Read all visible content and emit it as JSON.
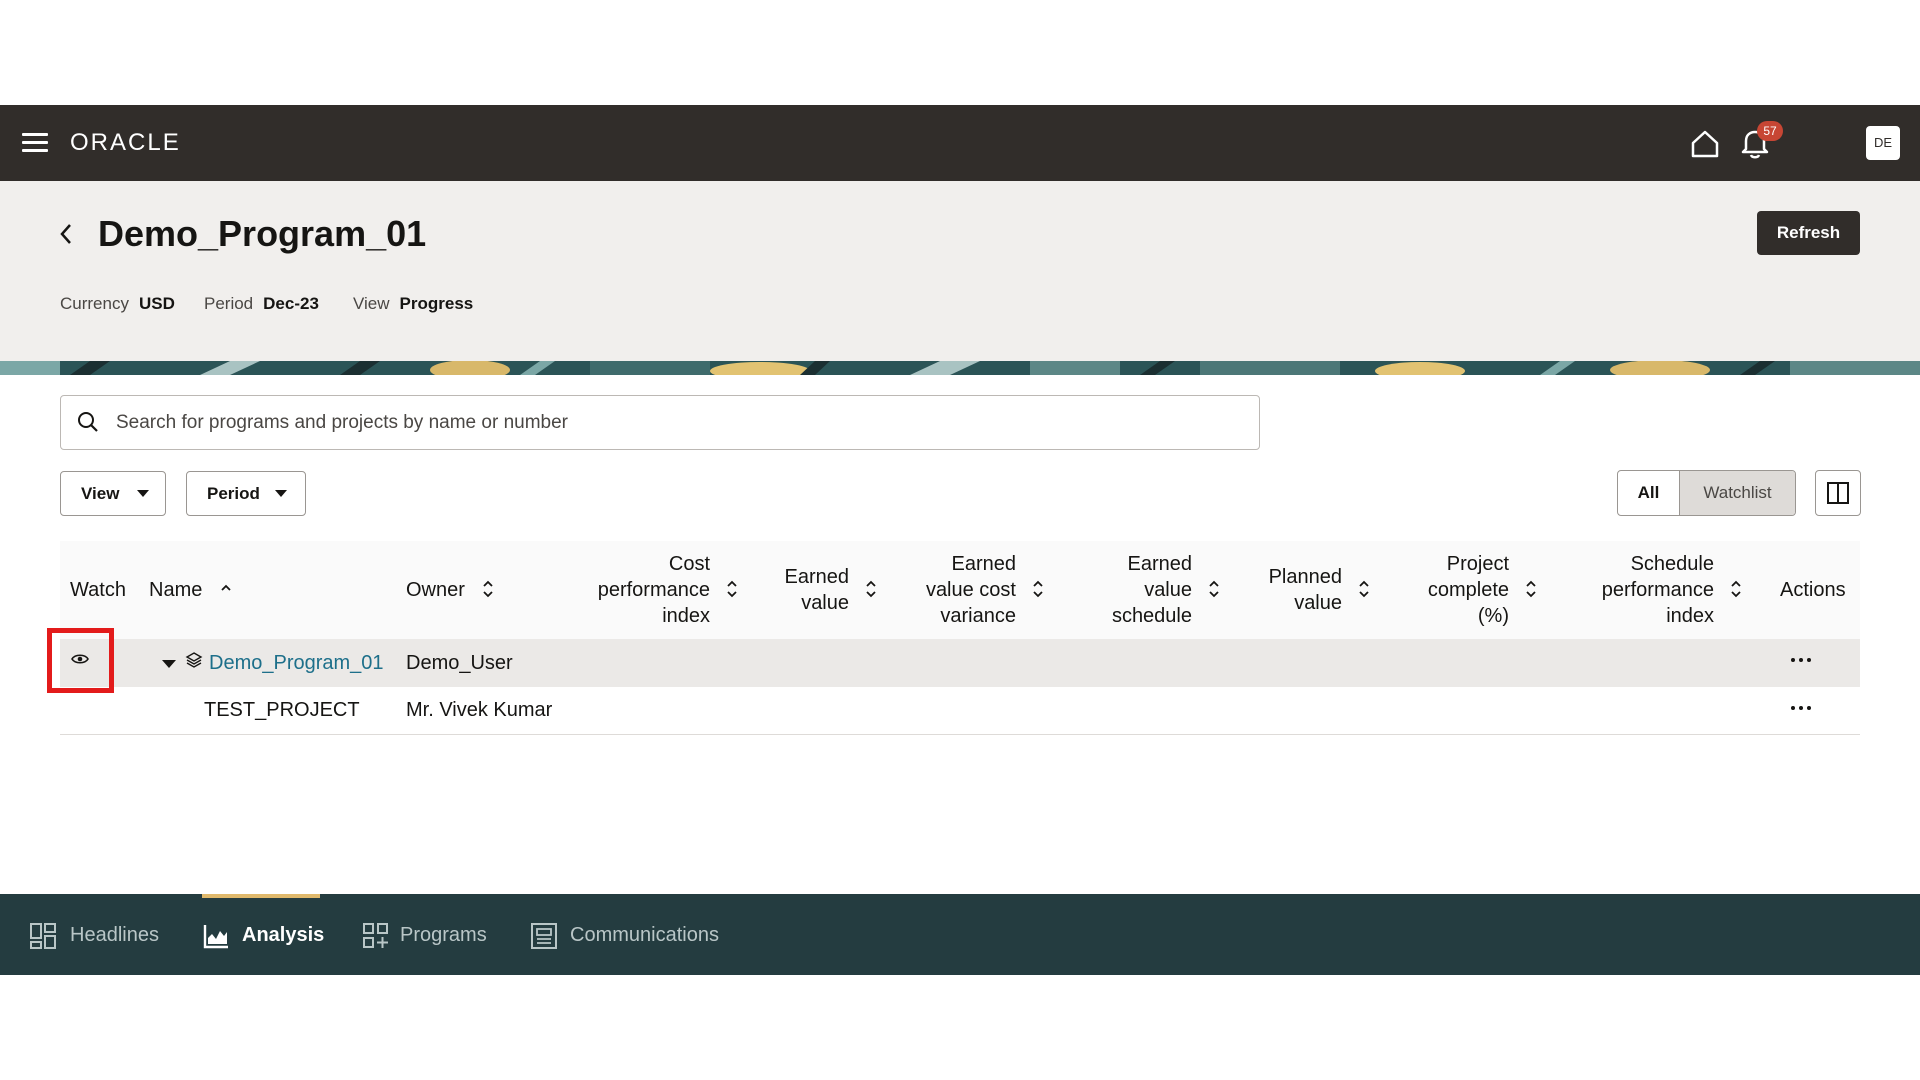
{
  "topbar": {
    "brand": "ORACLE",
    "notification_count": "57",
    "user_initials": "DE"
  },
  "header": {
    "title": "Demo_Program_01",
    "refresh_label": "Refresh",
    "meta": [
      {
        "label": "Currency",
        "value": "USD"
      },
      {
        "label": "Period",
        "value": "Dec-23"
      },
      {
        "label": "View",
        "value": "Progress"
      }
    ]
  },
  "search": {
    "placeholder": "Search for programs and projects by name or number"
  },
  "filters": {
    "view_label": "View",
    "period_label": "Period"
  },
  "toggle": {
    "all_label": "All",
    "watchlist_label": "Watchlist"
  },
  "table": {
    "columns": {
      "watch": "Watch",
      "name": "Name",
      "owner": "Owner",
      "cpi_1": "Cost",
      "cpi_2": "performance",
      "cpi_3": "index",
      "ev_1": "Earned",
      "ev_2": "value",
      "evcv_1": "Earned",
      "evcv_2": "value cost",
      "evcv_3": "variance",
      "evs_1": "Earned",
      "evs_2": "value",
      "evs_3": "schedule",
      "pv_1": "Planned",
      "pv_2": "value",
      "pc_1": "Project",
      "pc_2": "complete",
      "pc_3": "(%)",
      "spi_1": "Schedule",
      "spi_2": "performance",
      "spi_3": "index",
      "actions": "Actions"
    },
    "rows": [
      {
        "name": "Demo_Program_01",
        "owner": "Demo_User"
      },
      {
        "name": "TEST_PROJECT",
        "owner": "Mr. Vivek Kumar"
      }
    ]
  },
  "bottom_nav": [
    {
      "label": "Headlines",
      "icon": "dashboard-icon"
    },
    {
      "label": "Analysis",
      "icon": "chart-icon"
    },
    {
      "label": "Programs",
      "icon": "grid-plus-icon"
    },
    {
      "label": "Communications",
      "icon": "newspaper-icon"
    }
  ],
  "colors": {
    "topbar": "#312d2a",
    "header": "#f1efed",
    "bottomnav": "#243c40",
    "link": "#1d6f8a",
    "badge": "#c74634",
    "highlight": "#e31b1b"
  }
}
